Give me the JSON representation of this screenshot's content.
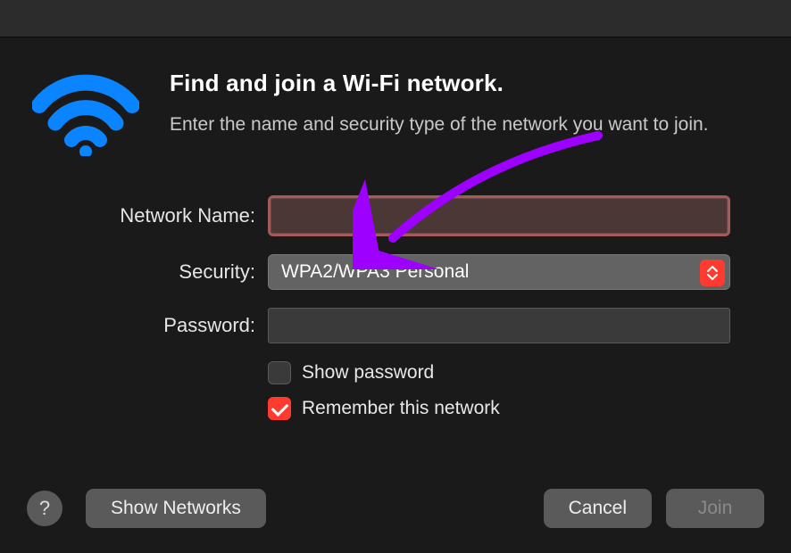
{
  "header": {
    "title": "Find and join a Wi-Fi network.",
    "subtitle": "Enter the name and security type of the network you want to join."
  },
  "form": {
    "network_name": {
      "label": "Network Name:",
      "value": ""
    },
    "security": {
      "label": "Security:",
      "selected": "WPA2/WPA3 Personal"
    },
    "password": {
      "label": "Password:",
      "value": ""
    },
    "show_password": {
      "label": "Show password",
      "checked": false
    },
    "remember": {
      "label": "Remember this network",
      "checked": true
    }
  },
  "buttons": {
    "help": "?",
    "show_networks": "Show Networks",
    "cancel": "Cancel",
    "join": "Join"
  },
  "icons": {
    "wifi": "wifi-icon",
    "stepper": "up-down-chevron-icon"
  },
  "colors": {
    "accent_blue": "#0a84ff",
    "accent_red": "#ff3b30",
    "highlight_border": "#a35b5a",
    "annotation_arrow": "#9d00ff"
  }
}
